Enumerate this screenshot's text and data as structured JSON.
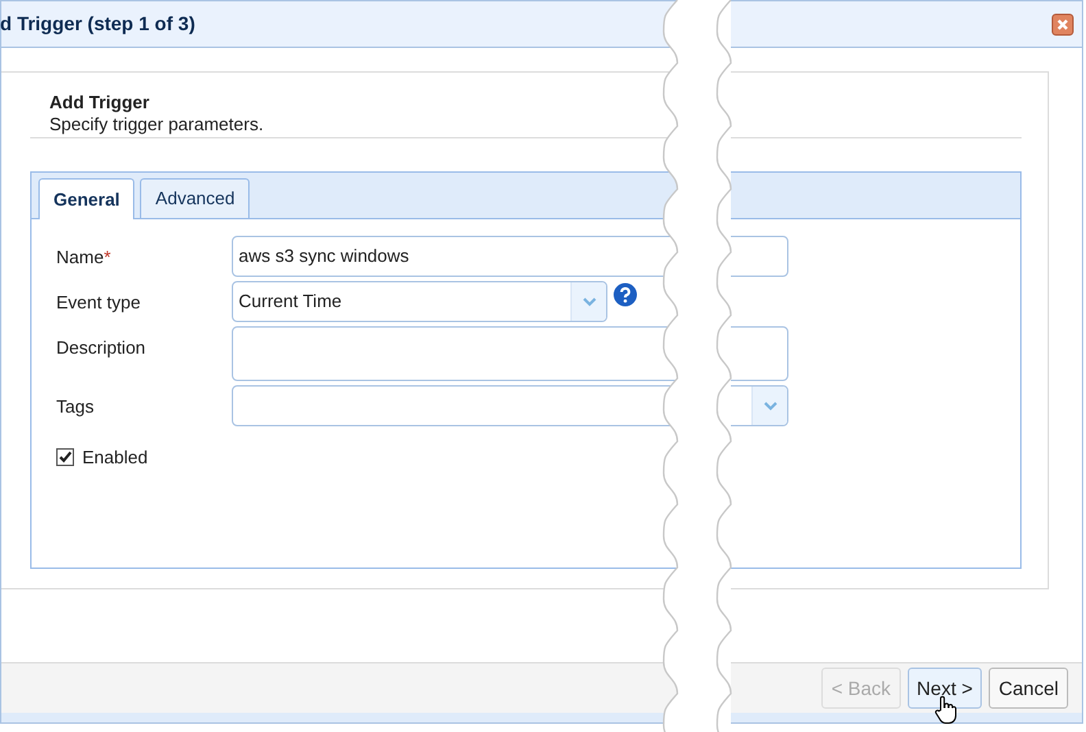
{
  "window": {
    "title": "d Trigger (step 1 of 3)"
  },
  "header": {
    "title": "Add Trigger",
    "subtitle": "Specify trigger parameters."
  },
  "tabs": [
    {
      "label": "General",
      "selected": true
    },
    {
      "label": "Advanced",
      "selected": false
    }
  ],
  "fields": [
    {
      "kind": "text",
      "label": "Name",
      "required_mark": "*",
      "value": "aws s3 sync windows"
    },
    {
      "kind": "select",
      "label": "Event type",
      "value": "Current Time",
      "help": true
    },
    {
      "kind": "textarea",
      "label": "Description"
    },
    {
      "kind": "select",
      "label": "Tags",
      "help": false
    }
  ],
  "enabled": {
    "label": "Enabled",
    "checked": true
  },
  "buttons": [
    {
      "label": "< Back",
      "disabled": true,
      "hovered": false
    },
    {
      "label": "Next >",
      "disabled": false,
      "hovered": true
    },
    {
      "label": "Cancel",
      "disabled": false,
      "hovered": false
    }
  ]
}
